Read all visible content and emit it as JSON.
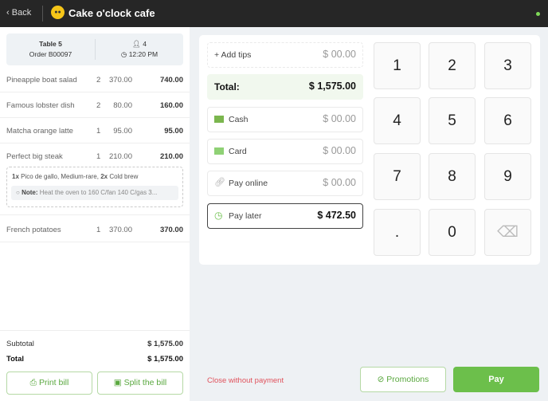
{
  "header": {
    "back": "Back",
    "title": "Cake o'clock cafe",
    "logo": "logo"
  },
  "summary": {
    "table": "Table 5",
    "order": "Order B00097",
    "guests": "4",
    "time": "12:20 PM"
  },
  "items": [
    {
      "name": "Pineapple boat salad",
      "qty": "2",
      "price": "370.00",
      "total": "740.00"
    },
    {
      "name": "Famous lobster dish",
      "qty": "2",
      "price": "80.00",
      "total": "160.00"
    },
    {
      "name": "Matcha orange latte",
      "qty": "1",
      "price": "95.00",
      "total": "95.00"
    },
    {
      "name": "Perfect big steak",
      "qty": "1",
      "price": "210.00",
      "total": "210.00"
    },
    {
      "name": "French potatoes",
      "qty": "1",
      "price": "370.00",
      "total": "370.00"
    }
  ],
  "modifier": {
    "q1": "1x",
    "m1": "Pico de gallo, Medium-rare,",
    "q2": "2x",
    "m2": "Cold brew",
    "note_label": "Note:",
    "note": "Heat the oven to 160 C/fan 140 C/gas 3..."
  },
  "totals": {
    "subtotal_label": "Subtotal",
    "subtotal": "$ 1,575.00",
    "total_label": "Total",
    "total": "$ 1,575.00"
  },
  "buttons": {
    "print": "Print bill",
    "split": "Split the bill",
    "close": "Close without payment",
    "promotions": "Promotions",
    "pay": "Pay"
  },
  "payment": {
    "tips_label": "+ Add tips",
    "tips": "$ 00.00",
    "total_label": "Total:",
    "total": "$ 1,575.00",
    "methods": [
      {
        "label": "Cash",
        "value": "$ 00.00"
      },
      {
        "label": "Card",
        "value": "$ 00.00"
      },
      {
        "label": "Pay online",
        "value": "$ 00.00"
      },
      {
        "label": "Pay later",
        "value": "$ 472.50"
      }
    ]
  },
  "keypad": [
    "1",
    "2",
    "3",
    "4",
    "5",
    "6",
    "7",
    "8",
    "9",
    ".",
    "0",
    "⌫"
  ],
  "colors": {
    "accent": "#6cbf4b",
    "danger": "#e0525c",
    "header": "#262626"
  }
}
